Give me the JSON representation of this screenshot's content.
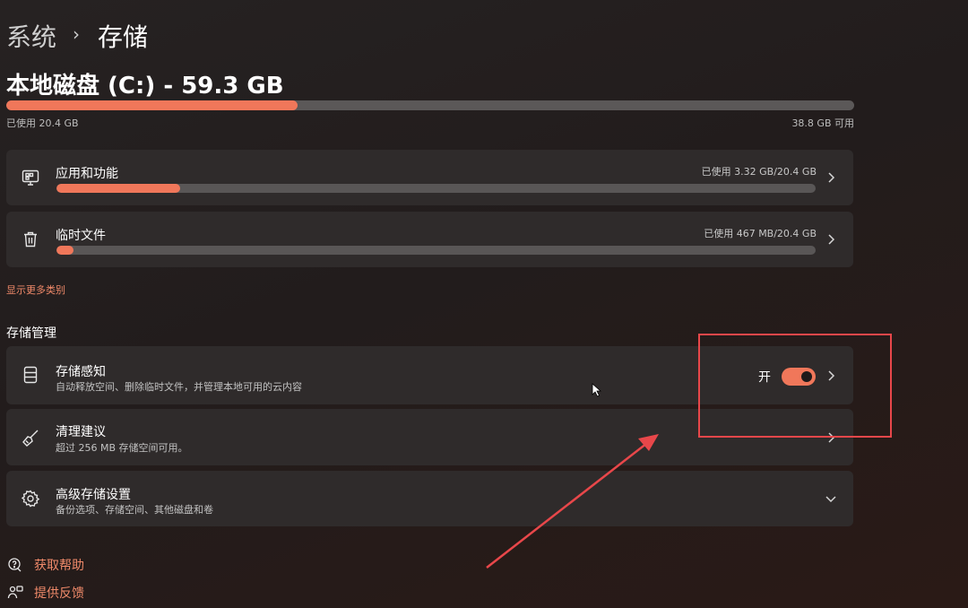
{
  "breadcrumb": {
    "parent": "系统",
    "separator": "›",
    "current": "存储"
  },
  "disk": {
    "title": "本地磁盘 (C:) - 59.3 GB",
    "used_fraction": 0.344,
    "used_label": "已使用 20.4 GB",
    "free_label": "38.8 GB 可用"
  },
  "categories": [
    {
      "icon": "monitor-apps-icon",
      "title": "应用和功能",
      "usage": "已使用 3.32 GB/20.4 GB",
      "fraction": 0.163
    },
    {
      "icon": "trash-icon",
      "title": "临时文件",
      "usage": "已使用 467 MB/20.4 GB",
      "fraction": 0.022
    }
  ],
  "show_more": "显示更多类别",
  "management": {
    "title": "存储管理",
    "items": [
      {
        "icon": "storage-drive-icon",
        "title": "存储感知",
        "subtitle": "自动释放空间、删除临时文件，并管理本地可用的云内容",
        "toggle_label": "开",
        "toggle_on": true
      },
      {
        "icon": "broom-icon",
        "title": "清理建议",
        "subtitle": "超过 256 MB 存储空间可用。"
      },
      {
        "icon": "gear-icon",
        "title": "高级存储设置",
        "subtitle": "备份选项、存储空间、其他磁盘和卷"
      }
    ]
  },
  "footer": {
    "help": "获取帮助",
    "feedback": "提供反馈"
  },
  "colors": {
    "accent": "#f0775a",
    "annotation": "#e8474a",
    "card": "#2f2b2b"
  }
}
